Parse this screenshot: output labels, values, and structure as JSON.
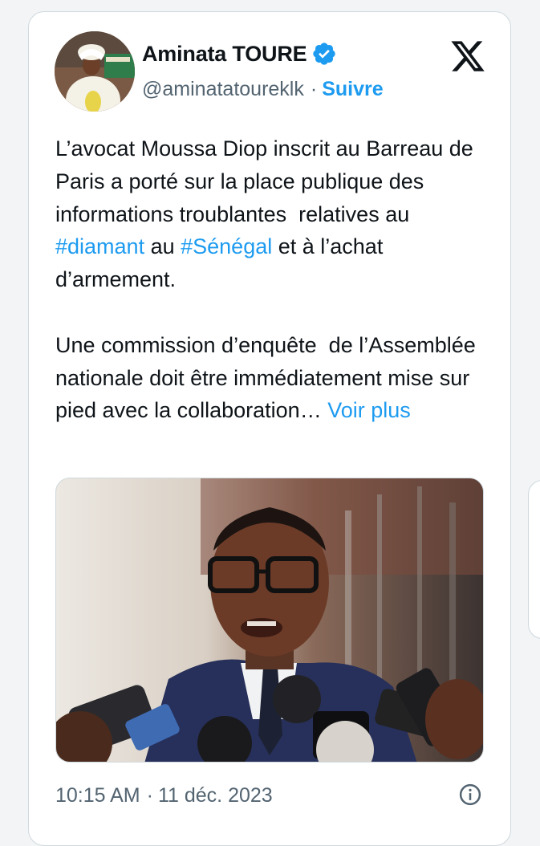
{
  "author": {
    "display_name": "Aminata TOURE",
    "handle": "@aminatatoureklk",
    "separator": "·",
    "follow_label": "Suivre",
    "verified": true,
    "verified_color": "#1d9bf0"
  },
  "platform_logo": "x-logo-icon",
  "tweet": {
    "p1_a": "L’avocat Moussa Diop inscrit au Barreau de Paris a porté sur la place publique des informations troublantes  relatives au ",
    "hashtag1": "#diamant",
    "p1_b": " au ",
    "hashtag2": "#Sénégal",
    "p1_c": " et à l’achat d’armement.",
    "p2": "Une commission d’enquête  de l’Assemblée nationale doit être immédiatement mise sur pied avec la collaboration… ",
    "more_label": "Voir plus"
  },
  "footer": {
    "time": "10:15 AM",
    "separator": "·",
    "date": "11 déc. 2023",
    "info_icon": "info-icon"
  },
  "colors": {
    "text": "#0f1419",
    "secondary": "#536471",
    "accent": "#1d9bf0",
    "border": "#cfd9de"
  }
}
